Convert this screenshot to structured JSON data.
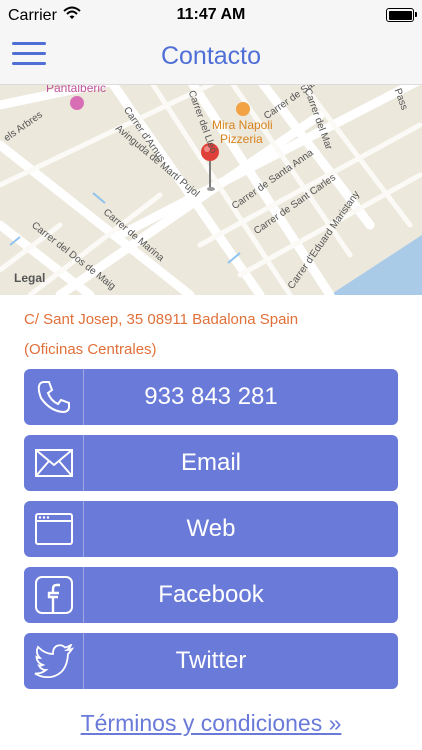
{
  "status_bar": {
    "carrier": "Carrier",
    "time": "11:47 AM",
    "battery_level": 1.0
  },
  "nav": {
    "title": "Contacto"
  },
  "map": {
    "labels": {
      "poi_1": "Pantalberic",
      "poi_2": "Mira Napoli",
      "poi_3": "Pizzeria",
      "street_1": "Carrer d'Arnus",
      "street_2": "Carrer del Lleó",
      "street_3": "Carrer del Mar",
      "street_4": "Carrer de Sant Pere",
      "street_5": "Pass",
      "street_6": "els Arbres",
      "street_7": "Avinguda de Martí Pujol",
      "street_8": "Carrer de Santa Anna",
      "street_9": "Carrer de Sant Carles",
      "street_10": "Carrer de Marina",
      "street_11": "Carrer del Dos de Maig",
      "street_12": "Carrer d'Eduard Maristany",
      "legal": "Legal"
    }
  },
  "address": {
    "line1": "C/ Sant Josep, 35 08911 Badalona Spain",
    "line2": "(Oficinas Centrales)"
  },
  "buttons": [
    {
      "label": "933 843 281",
      "icon": "phone-icon"
    },
    {
      "label": "Email",
      "icon": "envelope-icon"
    },
    {
      "label": "Web",
      "icon": "browser-window-icon"
    },
    {
      "label": "Facebook",
      "icon": "facebook-icon"
    },
    {
      "label": "Twitter",
      "icon": "twitter-icon"
    }
  ],
  "footer": {
    "terms_label": "Términos y condiciones »"
  },
  "colors": {
    "accent": "#4f6fd6",
    "button_bg": "#6a7ad8",
    "address_text": "#e0703a",
    "pin": "#e0403a"
  }
}
